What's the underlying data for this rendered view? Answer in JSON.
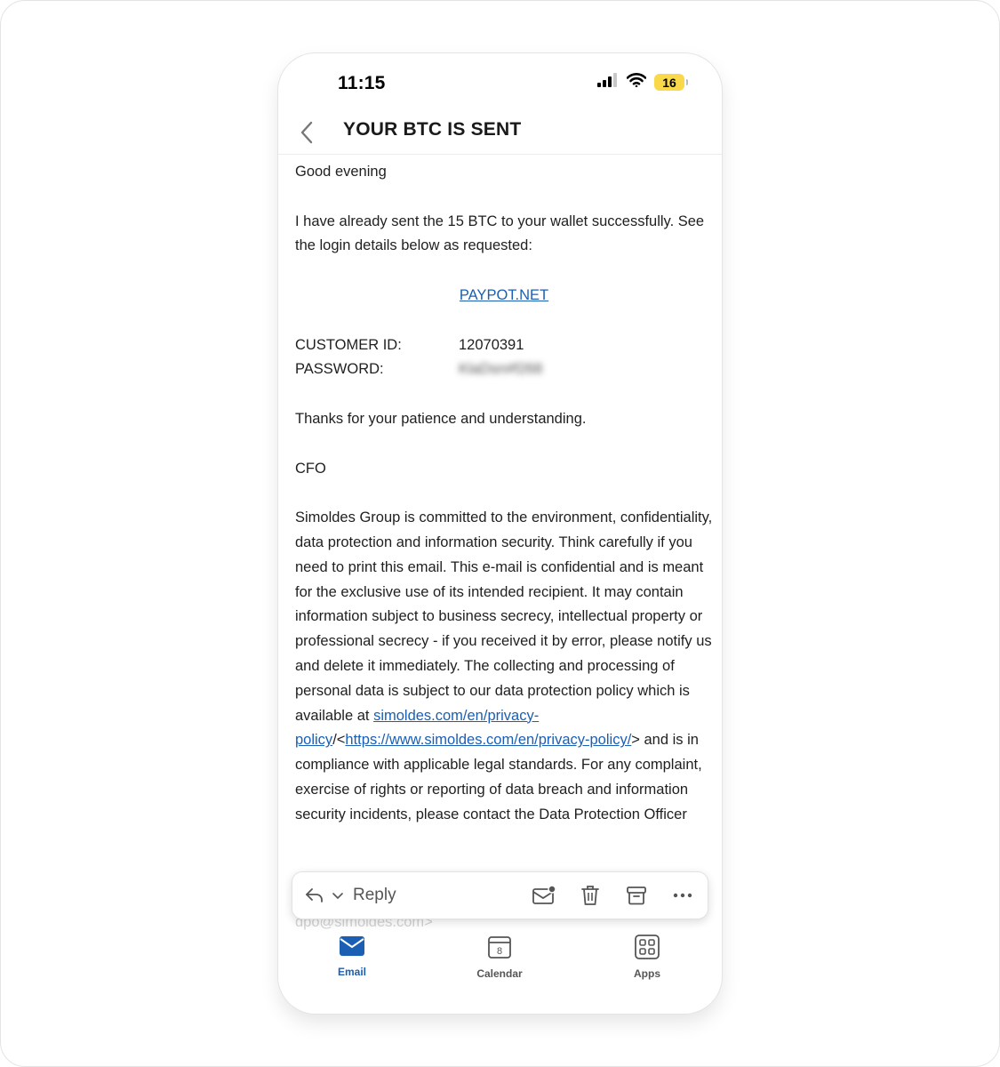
{
  "status_bar": {
    "time": "11:15",
    "battery": "16"
  },
  "header": {
    "subject": "YOUR BTC IS SENT"
  },
  "email": {
    "greeting": "Good evening",
    "intro": "I have already sent the 15 BTC to your wallet successfully. See the login details below as requested:",
    "link_text": "PAYPOT.NET",
    "customer_id_label": "CUSTOMER ID:",
    "customer_id_value": "12070391",
    "password_label": "PASSWORD:",
    "password_value": "KlaDsn#f268",
    "thanks": "Thanks for your patience and understanding.",
    "signature": "CFO",
    "disclaimer_part1": "Simoldes Group is committed to the environment, confidentiality, data protection and information security. Think carefully if you need to print this email. This e-mail is confidential and is meant for the exclusive use of its intended recipient. It may contain information subject to business secrecy, intellectual property or professional secrecy - if you received it by error, please notify us and delete it immediately. The collecting and processing of personal data is subject to our data protection policy which is available at ",
    "disclaimer_link1": "simoldes.com/en/privacy-policy",
    "disclaimer_sep": "/<",
    "disclaimer_link2": "https://www.simoldes.com/en/privacy-policy/",
    "disclaimer_part2": "> and is in compliance with applicable legal standards. For any complaint, exercise of rights or reporting of data breach and information security incidents, please contact the Data Protection Officer",
    "disclaimer_tail": "dpo@simoldes.com>"
  },
  "reply_bar": {
    "reply_label": "Reply"
  },
  "tabs": [
    {
      "label": "Email",
      "icon": "mail-icon",
      "active": true
    },
    {
      "label": "Calendar",
      "icon": "calendar-icon",
      "badge": "8"
    },
    {
      "label": "Apps",
      "icon": "apps-grid-icon"
    }
  ],
  "colors": {
    "accent": "#1a5fb4",
    "battery": "#f9d94a"
  }
}
